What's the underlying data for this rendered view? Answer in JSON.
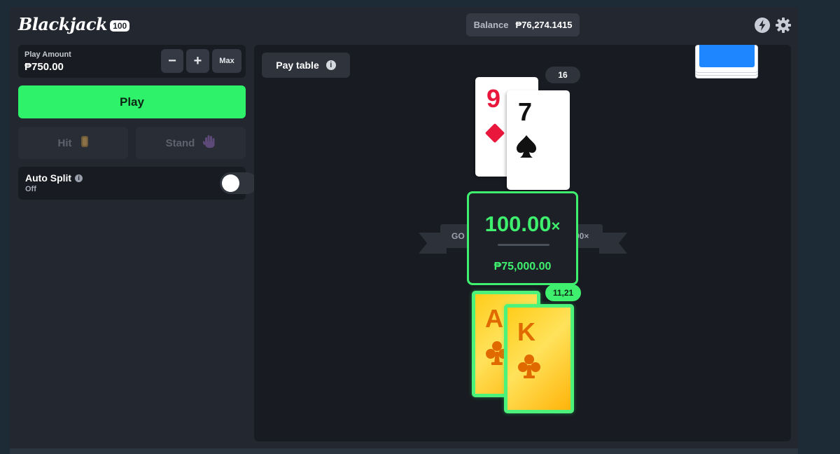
{
  "header": {
    "logo_text": "Blackjack",
    "logo_badge": "100",
    "balance_label": "Balance",
    "balance_value": "₱76,274.1415"
  },
  "controls": {
    "play_amount_label": "Play Amount",
    "play_amount_value": "₱750.00",
    "minus_label": "−",
    "plus_label": "+",
    "max_label": "Max",
    "play_label": "Play",
    "hit_label": "Hit",
    "stand_label": "Stand",
    "auto_split_label": "Auto Split",
    "auto_split_state": "Off"
  },
  "table": {
    "pay_table_label": "Pay table",
    "dealer_score": "16",
    "dealer_cards": [
      {
        "rank": "9",
        "suit": "diamond",
        "color": "#e8173b"
      },
      {
        "rank": "7",
        "suit": "spade",
        "color": "#111111"
      }
    ],
    "player_score": "11,21",
    "player_cards": [
      {
        "rank": "A",
        "suit": "club"
      },
      {
        "rank": "K",
        "suit": "club"
      }
    ],
    "ribbon_left_text": "GO",
    "ribbon_right_text": "00×",
    "multiplier": "100.00",
    "multiplier_suffix": "×",
    "win_amount": "₱75,000.00"
  },
  "colors": {
    "accent_green": "#2ef36a",
    "deck_blue": "#1e86ff",
    "gold": "#ffcc1a"
  }
}
